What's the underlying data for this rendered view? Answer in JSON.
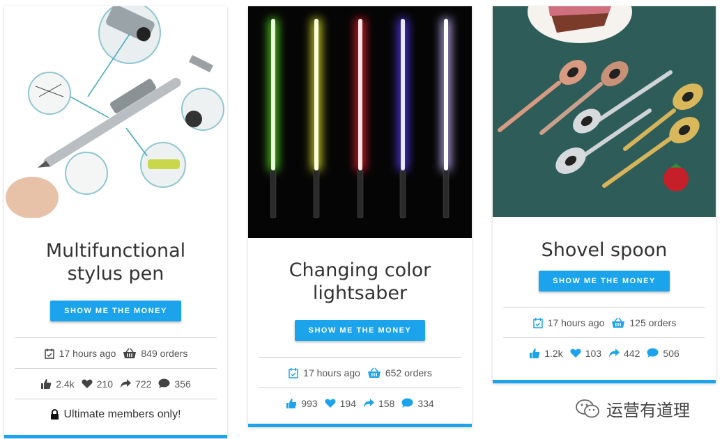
{
  "button_label": "SHOW ME THE MONEY",
  "accent_color": "#1ba3ec",
  "cards": [
    {
      "title": "Multifunctional stylus pen",
      "image": "stylus-pen-photo",
      "time": "17 hours ago",
      "orders": "849 orders",
      "likes": "2.4k",
      "hearts": "210",
      "shares": "722",
      "comments": "356",
      "icon_style": "dark",
      "members_note": "Ultimate members only!"
    },
    {
      "title": "Changing color lightsaber",
      "image": "lightsaber-photo",
      "time": "17 hours ago",
      "orders": "652 orders",
      "likes": "993",
      "hearts": "194",
      "shares": "158",
      "comments": "334",
      "icon_style": "blue"
    },
    {
      "title": "Shovel spoon",
      "image": "shovel-spoon-photo",
      "time": "17 hours ago",
      "orders": "125 orders",
      "likes": "1.2k",
      "hearts": "103",
      "shares": "442",
      "comments": "506",
      "icon_style": "blue"
    }
  ],
  "watermark": "运营有道理"
}
